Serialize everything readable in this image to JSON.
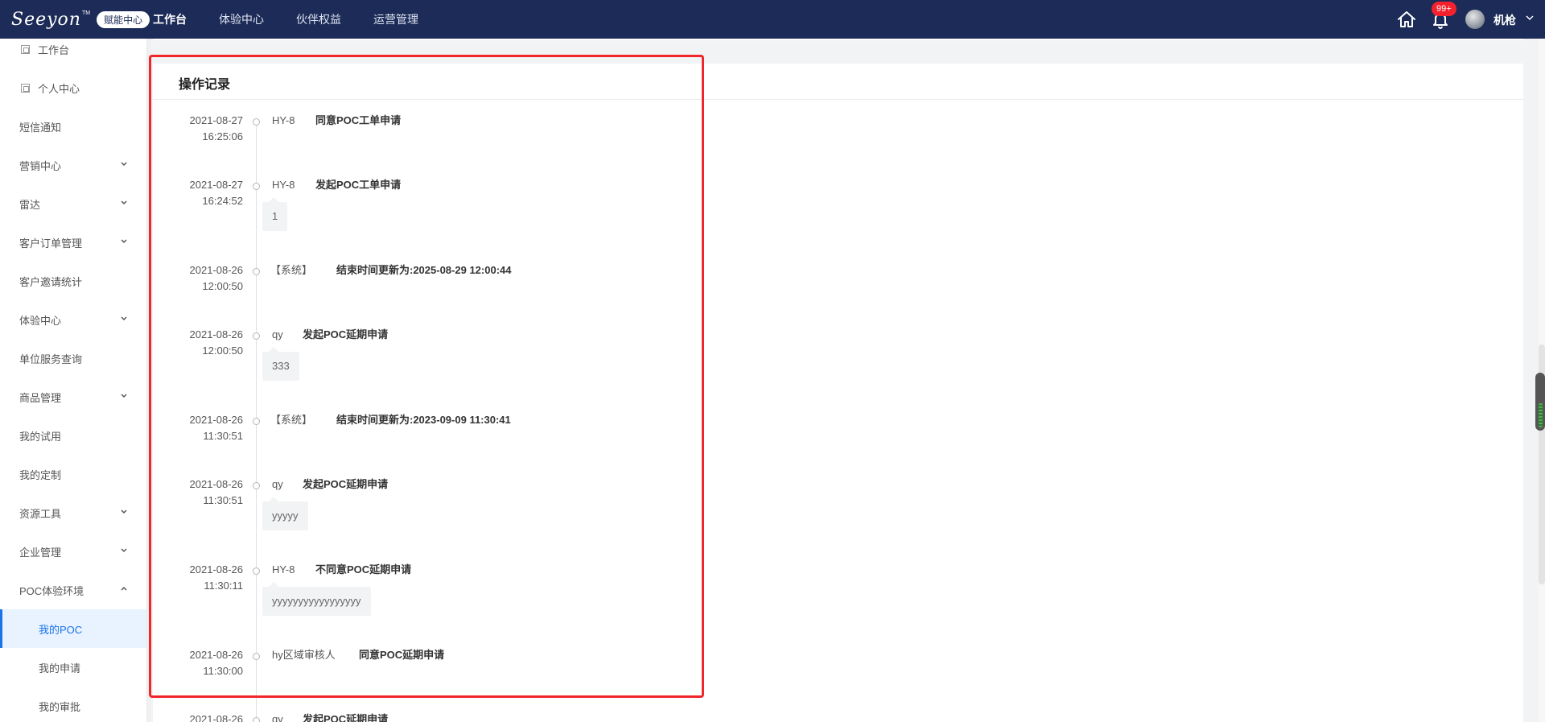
{
  "header": {
    "logo_text": "Seeyon",
    "logo_tm": "TM",
    "logo_badge": "赋能中心",
    "nav": [
      "工作台",
      "体验中心",
      "伙伴权益",
      "运营管理"
    ],
    "notification_count": "99+",
    "user_name": "机枪",
    "icons": {
      "home": "home-icon",
      "bell": "bell-icon",
      "chevron": "chevron-down-icon"
    }
  },
  "sidebar": {
    "items": [
      {
        "label": "工作台",
        "icon": "page-icon"
      },
      {
        "label": "个人中心",
        "icon": "page-icon"
      },
      {
        "label": "短信通知"
      },
      {
        "label": "营销中心",
        "expand": "down"
      },
      {
        "label": "雷达",
        "expand": "down"
      },
      {
        "label": "客户订单管理",
        "expand": "down"
      },
      {
        "label": "客户邀请统计"
      },
      {
        "label": "体验中心",
        "expand": "down"
      },
      {
        "label": "单位服务查询"
      },
      {
        "label": "商品管理",
        "expand": "down"
      },
      {
        "label": "我的试用"
      },
      {
        "label": "我的定制"
      },
      {
        "label": "资源工具",
        "expand": "down"
      },
      {
        "label": "企业管理",
        "expand": "down"
      },
      {
        "label": "POC体验环境",
        "expand": "up"
      },
      {
        "label": "我的POC",
        "active": true
      },
      {
        "label": "我的申请"
      },
      {
        "label": "我的审批"
      }
    ]
  },
  "main": {
    "card_title": "操作记录",
    "records": [
      {
        "date": "2021-08-27",
        "time": "16:25:06",
        "user": "HY-8",
        "action": "同意POC工单申请",
        "comment": ""
      },
      {
        "date": "2021-08-27",
        "time": "16:24:52",
        "user": "HY-8",
        "action": "发起POC工单申请",
        "comment": "1"
      },
      {
        "date": "2021-08-26",
        "time": "12:00:50",
        "user": "【系统】",
        "action": "结束时间更新为:2025-08-29 12:00:44",
        "comment": ""
      },
      {
        "date": "2021-08-26",
        "time": "12:00:50",
        "user": "qy",
        "action": "发起POC延期申请",
        "comment": "333"
      },
      {
        "date": "2021-08-26",
        "time": "11:30:51",
        "user": "【系统】",
        "action": "结束时间更新为:2023-09-09 11:30:41",
        "comment": ""
      },
      {
        "date": "2021-08-26",
        "time": "11:30:51",
        "user": "qy",
        "action": "发起POC延期申请",
        "comment": "yyyyy"
      },
      {
        "date": "2021-08-26",
        "time": "11:30:11",
        "user": "HY-8",
        "action": "不同意POC延期申请",
        "comment": "yyyyyyyyyyyyyyyyy"
      },
      {
        "date": "2021-08-26",
        "time": "11:30:00",
        "user": "hy区域审核人",
        "action": "同意POC延期申请",
        "comment": ""
      },
      {
        "date": "2021-08-26",
        "time": "",
        "user": "qy",
        "action": "发起POC延期申请",
        "comment": ""
      }
    ]
  },
  "colors": {
    "topbar": "#1c2b57",
    "accent": "#1a73e8",
    "highlight": "#f0262a",
    "badge": "#f5222d"
  }
}
